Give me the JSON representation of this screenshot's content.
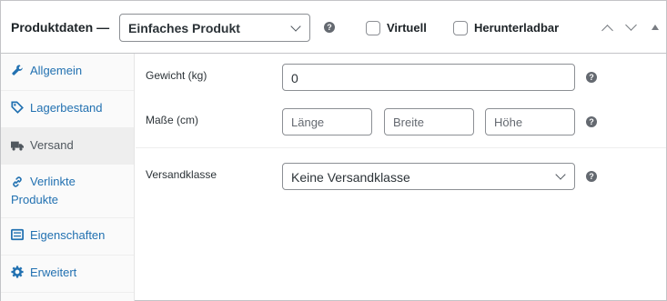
{
  "header": {
    "title": "Produktdaten —",
    "product_type": {
      "selected": "Einfaches Produkt"
    },
    "virtual_label": "Virtuell",
    "downloadable_label": "Herunterladbar"
  },
  "sidebar": {
    "items": [
      {
        "label": "Allgemein",
        "icon": "wrench-icon",
        "active": false
      },
      {
        "label": "Lagerbestand",
        "icon": "tag-icon",
        "active": false
      },
      {
        "label": "Versand",
        "icon": "truck-icon",
        "active": true
      },
      {
        "label_line1": "Verlinkte",
        "label_line2": "Produkte",
        "icon": "link-icon",
        "active": false
      },
      {
        "label": "Eigenschaften",
        "icon": "list-icon",
        "active": false
      },
      {
        "label": "Erweitert",
        "icon": "gear-icon",
        "active": false
      }
    ]
  },
  "shipping": {
    "weight_label": "Gewicht (kg)",
    "weight_value": "0",
    "dimensions_label": "Maße (cm)",
    "length_placeholder": "Länge",
    "width_placeholder": "Breite",
    "height_placeholder": "Höhe",
    "class_label": "Versandklasse",
    "class_selected": "Keine Versandklasse"
  },
  "colors": {
    "link": "#2271b1",
    "border": "#8c8f94",
    "help_icon": "#646970"
  }
}
